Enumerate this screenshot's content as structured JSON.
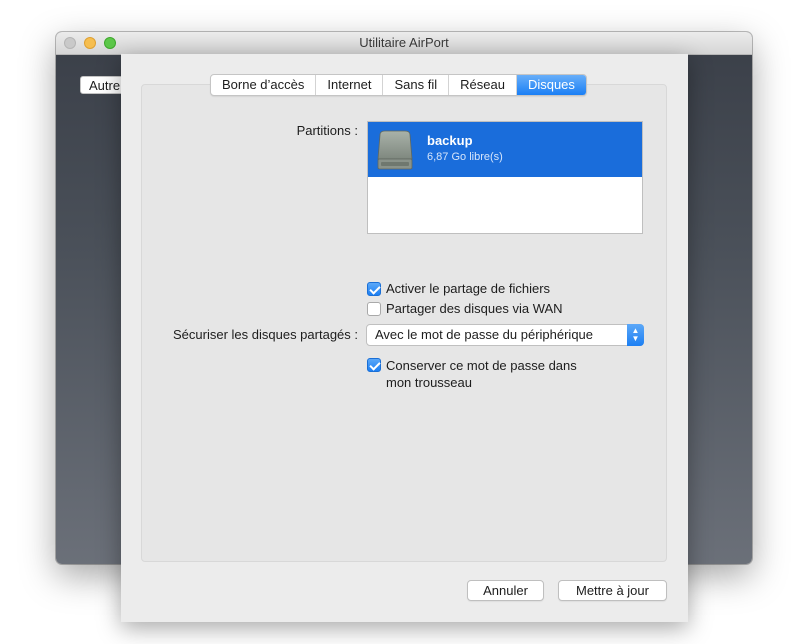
{
  "window": {
    "title": "Utilitaire AirPort",
    "background_button": "Autre"
  },
  "tabs": [
    {
      "label": "Borne d’accès",
      "active": false
    },
    {
      "label": "Internet",
      "active": false
    },
    {
      "label": "Sans fil",
      "active": false
    },
    {
      "label": "Réseau",
      "active": false
    },
    {
      "label": "Disques",
      "active": true
    }
  ],
  "partitions": {
    "label": "Partitions :",
    "items": [
      {
        "name": "backup",
        "free": "6,87 Go libre(s)",
        "selected": true
      }
    ]
  },
  "options": {
    "file_sharing": {
      "label": "Activer le partage de fichiers",
      "checked": true
    },
    "wan_sharing": {
      "label": "Partager des disques via WAN",
      "checked": false
    },
    "secure_label": "Sécuriser les disques partagés :",
    "secure_value": "Avec le mot de passe du périphérique",
    "keychain": {
      "label_line1": "Conserver ce mot de passe dans",
      "label_line2": "mon trousseau",
      "checked": true
    }
  },
  "buttons": {
    "cancel": "Annuler",
    "update": "Mettre à jour"
  },
  "colors": {
    "accent": "#1a7ff5",
    "selection": "#1a6ddb"
  }
}
